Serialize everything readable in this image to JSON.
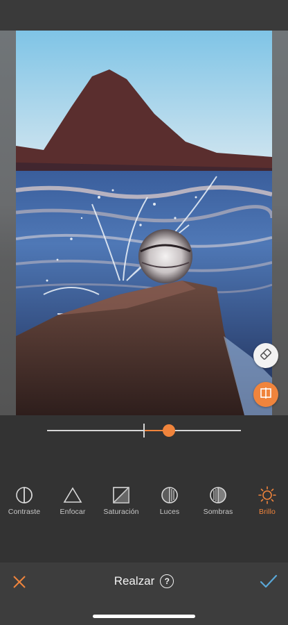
{
  "editor": {
    "title": "Realzar",
    "help_label": "?",
    "brightness_level": 0.63
  },
  "tools": [
    {
      "id": "contrast",
      "label": "Contraste",
      "icon": "contrast-icon"
    },
    {
      "id": "focus",
      "label": "Enfocar",
      "icon": "triangle-icon"
    },
    {
      "id": "saturation",
      "label": "Saturación",
      "icon": "saturation-icon"
    },
    {
      "id": "lights",
      "label": "Luces",
      "icon": "lights-icon"
    },
    {
      "id": "shadows",
      "label": "Sombras",
      "icon": "shadows-icon"
    },
    {
      "id": "brightness",
      "label": "Brillo",
      "icon": "sun-icon",
      "active": true
    }
  ],
  "colors": {
    "accent": "#f0843c",
    "panel": "#333333",
    "bottom_bar": "#3d3d3d",
    "confirm": "#5aa8d8"
  }
}
